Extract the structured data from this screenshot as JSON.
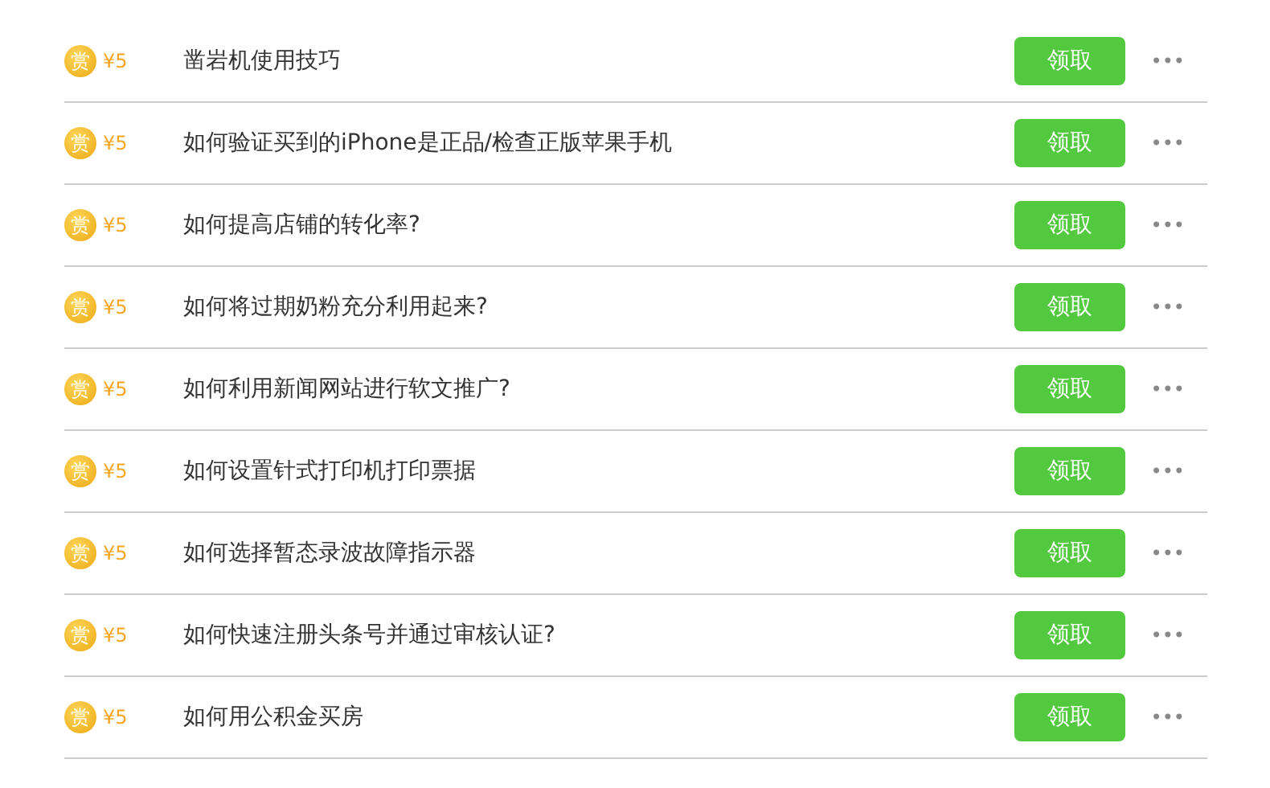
{
  "tasks": [
    {
      "coin": "赏",
      "reward": "¥5",
      "title": "凿岩机使用技巧",
      "action": "领取",
      "more": "•••"
    },
    {
      "coin": "赏",
      "reward": "¥5",
      "title": "如何验证买到的iPhone是正品/检查正版苹果手机",
      "action": "领取",
      "more": "•••"
    },
    {
      "coin": "赏",
      "reward": "¥5",
      "title": "如何提高店铺的转化率?",
      "action": "领取",
      "more": "•••"
    },
    {
      "coin": "赏",
      "reward": "¥5",
      "title": "如何将过期奶粉充分利用起来?",
      "action": "领取",
      "more": "•••"
    },
    {
      "coin": "赏",
      "reward": "¥5",
      "title": "如何利用新闻网站进行软文推广?",
      "action": "领取",
      "more": "•••"
    },
    {
      "coin": "赏",
      "reward": "¥5",
      "title": "如何设置针式打印机打印票据",
      "action": "领取",
      "more": "•••"
    },
    {
      "coin": "赏",
      "reward": "¥5",
      "title": "如何选择暂态录波故障指示器",
      "action": "领取",
      "more": "•••"
    },
    {
      "coin": "赏",
      "reward": "¥5",
      "title": "如何快速注册头条号并通过审核认证?",
      "action": "领取",
      "more": "•••"
    },
    {
      "coin": "赏",
      "reward": "¥5",
      "title": "如何用公积金买房",
      "action": "领取",
      "more": "•••"
    }
  ]
}
